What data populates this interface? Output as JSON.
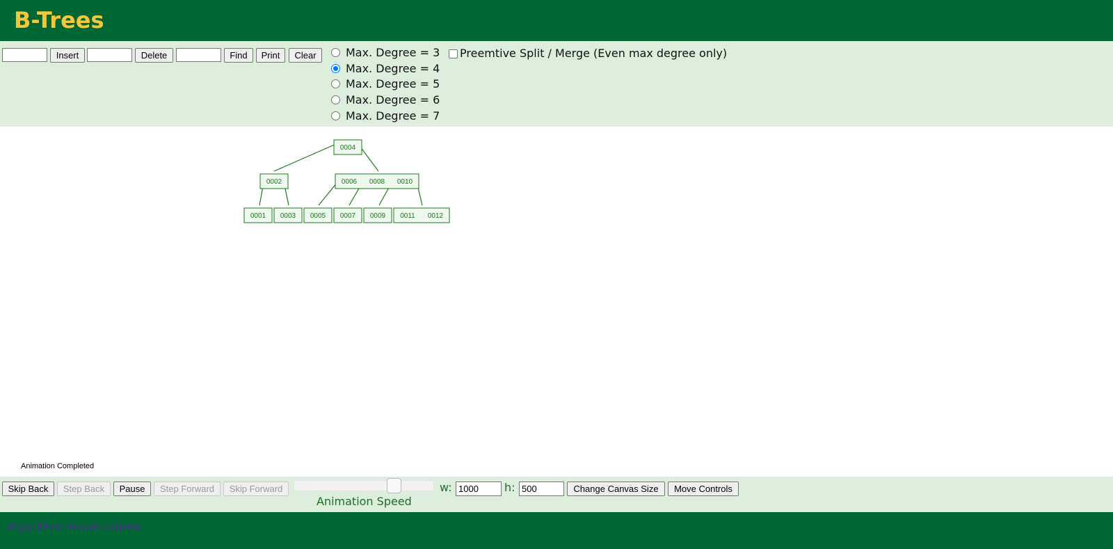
{
  "header": {
    "title": "B-Trees"
  },
  "toolbar": {
    "insert_value": "",
    "insert_label": "Insert",
    "delete_value": "",
    "delete_label": "Delete",
    "find_value": "",
    "find_label": "Find",
    "print_label": "Print",
    "clear_label": "Clear"
  },
  "degree_options": [
    {
      "label": "Max. Degree = 3",
      "checked": false
    },
    {
      "label": "Max. Degree = 4",
      "checked": true
    },
    {
      "label": "Max. Degree = 5",
      "checked": false
    },
    {
      "label": "Max. Degree = 6",
      "checked": false
    },
    {
      "label": "Max. Degree = 7",
      "checked": false
    }
  ],
  "preemptive": {
    "label": "Preemtive Split / Merge (Even max degree only)",
    "checked": false
  },
  "tree": {
    "root": [
      "0004"
    ],
    "level1": [
      [
        "0002"
      ],
      [
        "0006",
        "0008",
        "0010"
      ]
    ],
    "leaves": [
      [
        "0001"
      ],
      [
        "0003"
      ],
      [
        "0005"
      ],
      [
        "0007"
      ],
      [
        "0009"
      ],
      [
        "0011",
        "0012"
      ]
    ],
    "color": "#1a7a1a",
    "node_fill": "#eef8ee"
  },
  "status": {
    "text": "Animation Completed"
  },
  "playback": {
    "skip_back": "Skip Back",
    "step_back": "Step Back",
    "pause": "Pause",
    "step_forward": "Step Forward",
    "skip_forward": "Skip Forward",
    "speed_label": "Animation Speed",
    "speed_fraction": 0.74
  },
  "canvas_size": {
    "w_label": "w:",
    "w_value": "1000",
    "h_label": "h:",
    "h_value": "500",
    "change_label": "Change Canvas Size",
    "move_label": "Move Controls"
  },
  "footer": {
    "link_text": "Algorithm Visualizations"
  },
  "colors": {
    "header_bg": "#006633",
    "title": "#f5c73a",
    "panel_bg": "#ddeedd",
    "accent": "#0075ff"
  }
}
